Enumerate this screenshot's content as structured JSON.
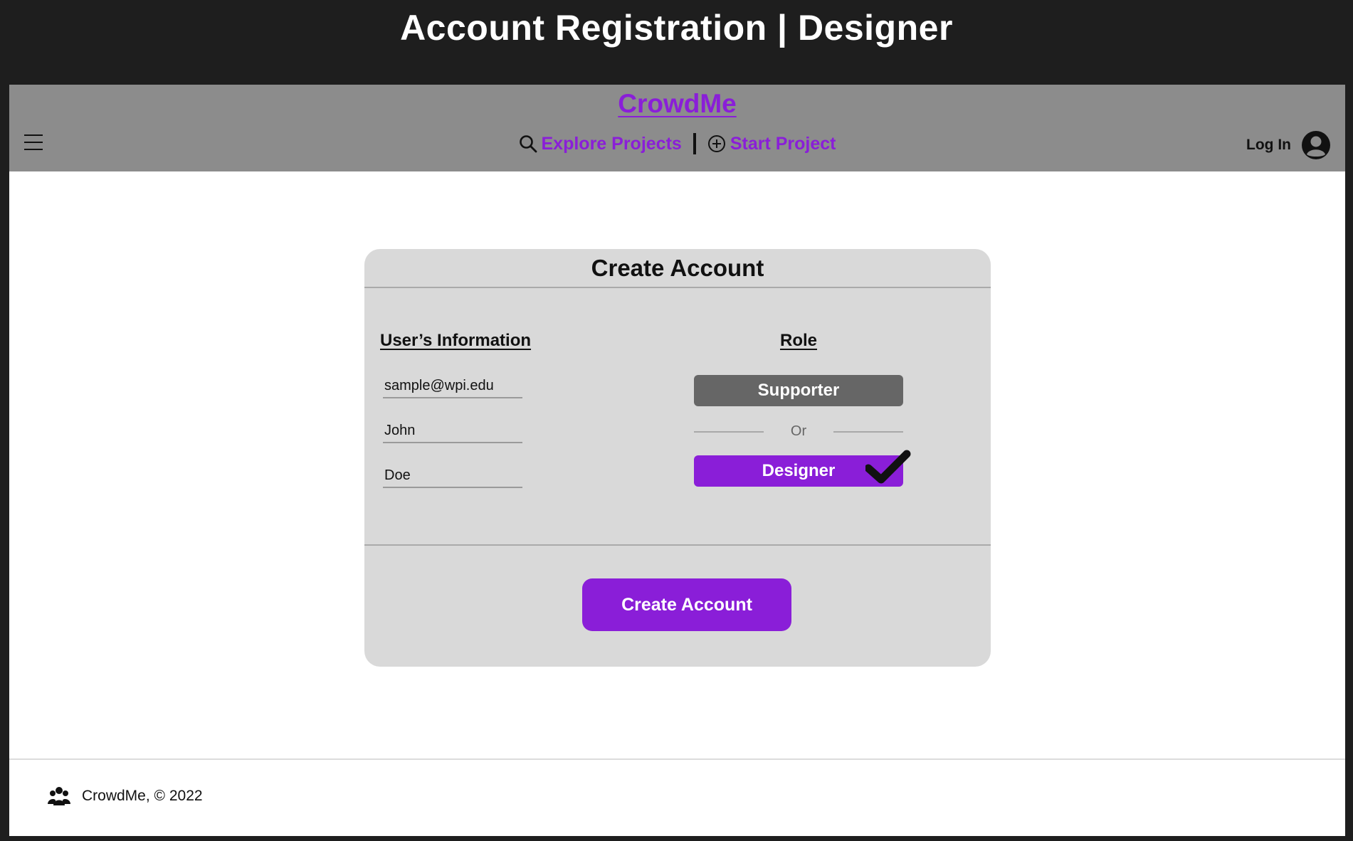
{
  "frame_title": "Account Registration | Designer",
  "navbar": {
    "brand": "CrowdMe",
    "explore_label": "Explore Projects",
    "start_label": "Start Project",
    "login_label": "Log In"
  },
  "card": {
    "title": "Create Account",
    "user_info_heading": "User’s Information",
    "role_heading": "Role",
    "fields": {
      "email": "sample@wpi.edu",
      "first_name": "John",
      "last_name": "Doe"
    },
    "roles": {
      "supporter": "Supporter",
      "or": "Or",
      "designer": "Designer",
      "selected": "Designer"
    },
    "submit_label": "Create Account"
  },
  "footer": {
    "text": "CrowdMe, © 2022"
  },
  "colors": {
    "accent": "#8a1ed8",
    "navbar": "#8c8c8c",
    "card": "#d9d9d9",
    "supporter_button": "#666666",
    "frame": "#1e1e1e"
  },
  "icons": {
    "menu": "hamburger-menu-icon",
    "search": "search-icon",
    "start": "plus-circle-icon",
    "avatar": "user-avatar-icon",
    "selected": "checkmark-icon",
    "footer": "group-icon"
  }
}
